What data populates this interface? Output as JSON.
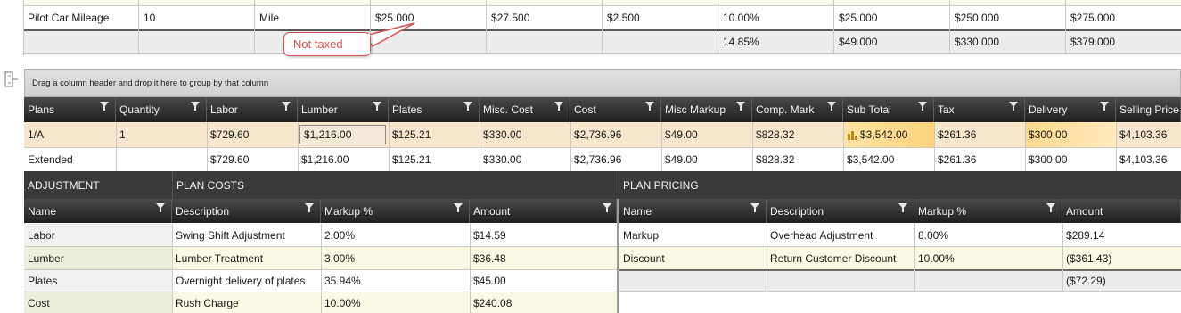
{
  "top_grid": {
    "rows": [
      [
        "Pilot Car Mileage",
        "10",
        "Mile",
        "$25.000",
        "$27.500",
        "$2.500",
        "10.00%",
        "$25.000",
        "$250.000",
        "$275.000"
      ],
      [
        "",
        "",
        "",
        "",
        "",
        "",
        "14.85%",
        "$49.000",
        "$330.000",
        "$379.000"
      ]
    ]
  },
  "callout": {
    "text": "Not taxed"
  },
  "group_panel": {
    "hint": "Drag a column header and drop it here to group by that column"
  },
  "plans_grid": {
    "columns": [
      "Plans",
      "Quantity",
      "Labor",
      "Lumber",
      "Plates",
      "Misc. Cost",
      "Cost",
      "Misc Markup",
      "Comp. Mark",
      "Sub Total",
      "Tax",
      "Delivery",
      "Selling Price"
    ],
    "rows": [
      [
        "1/A",
        "1",
        "$729.60",
        "$1,216.00",
        "$125.21",
        "$330.00",
        "$2,736.96",
        "$49.00",
        "$828.32",
        "$3,542.00",
        "$261.36",
        "$300.00",
        "$4,103.36"
      ],
      [
        "Extended",
        "",
        "$729.60",
        "$1,216.00",
        "$125.21",
        "$330.00",
        "$2,736.96",
        "$49.00",
        "$828.32",
        "$3,542.00",
        "$261.36",
        "$300.00",
        "$4,103.36"
      ]
    ]
  },
  "sections": {
    "adjustment": "ADJUSTMENT",
    "plan_costs": "PLAN COSTS",
    "plan_pricing": "PLAN PRICING"
  },
  "costs_grid": {
    "columns": [
      "Name",
      "Description",
      "Markup %",
      "Amount"
    ],
    "rows": [
      [
        "Labor",
        "Swing Shift Adjustment",
        "2.00%",
        "$14.59"
      ],
      [
        "Lumber",
        "Lumber Treatment",
        "3.00%",
        "$36.48"
      ],
      [
        "Plates",
        "Overnight delivery of plates",
        "35.94%",
        "$45.00"
      ],
      [
        "Cost",
        "Rush Charge",
        "10.00%",
        "$240.08"
      ]
    ]
  },
  "pricing_grid": {
    "columns": [
      "Name",
      "Description",
      "Markup %",
      "Amount"
    ],
    "rows": [
      [
        "Markup",
        "Overhead Adjustment",
        "8.00%",
        "$289.14"
      ],
      [
        "Discount",
        "Return Customer Discount",
        "10.00%",
        "($361.43)"
      ],
      [
        "",
        "",
        "",
        "($72.29)"
      ]
    ]
  },
  "colors": {
    "header_dark": "#2a2a2a",
    "row_selected": "#f5e6cc",
    "row_alt": "#fbf8e4",
    "subtotal_highlight": "#ffd98a",
    "callout_border": "#d9534f",
    "callout_text": "#d9534f"
  },
  "icons": {
    "filter": "filter-icon",
    "sort_indicator": "sum-icon",
    "panel_toggle": "panel-toggle-icon"
  }
}
